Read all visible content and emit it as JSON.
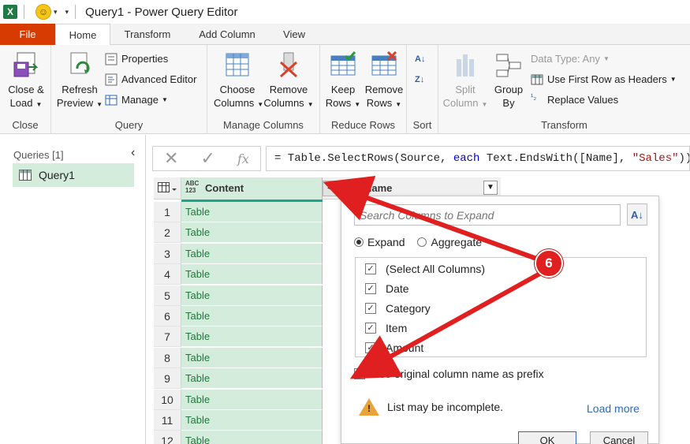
{
  "window": {
    "app_logo": "X",
    "title": "Query1 - Power Query Editor",
    "smiley": "☺"
  },
  "tabs": [
    {
      "label": "File"
    },
    {
      "label": "Home"
    },
    {
      "label": "Transform"
    },
    {
      "label": "Add Column"
    },
    {
      "label": "View"
    }
  ],
  "ribbon": {
    "close": {
      "close_load_line1": "Close &",
      "close_load_line2": "Load",
      "group": "Close"
    },
    "query": {
      "refresh_line1": "Refresh",
      "refresh_line2": "Preview",
      "properties": "Properties",
      "advanced_editor": "Advanced Editor",
      "manage": "Manage",
      "group": "Query"
    },
    "manage_columns": {
      "choose_line1": "Choose",
      "choose_line2": "Columns",
      "remove_line1": "Remove",
      "remove_line2": "Columns",
      "group": "Manage Columns"
    },
    "reduce_rows": {
      "keep_line1": "Keep",
      "keep_line2": "Rows",
      "remove_line1": "Remove",
      "remove_line2": "Rows",
      "group": "Reduce Rows"
    },
    "sort": {
      "group": "Sort"
    },
    "transform": {
      "split_line1": "Split",
      "split_line2": "Column",
      "group_by_line1": "Group",
      "group_by_line2": "By",
      "data_type": "Data Type: Any",
      "first_row_headers": "Use First Row as Headers",
      "replace_values": "Replace Values",
      "group": "Transform"
    }
  },
  "queries": {
    "header": "Queries [1]",
    "items": [
      {
        "label": "Query1"
      }
    ]
  },
  "formula": {
    "prefix": "= Table.SelectRows(Source, ",
    "keyword": "each",
    "middle": " Text.EndsWith([Name], ",
    "string": "\"Sales\"",
    "suffix": "))"
  },
  "grid": {
    "columns": [
      {
        "label": "Content",
        "type_top": "ABC",
        "type_bottom": "123"
      },
      {
        "label": "Name",
        "type_top": "A",
        "type_bottom": "B"
      }
    ],
    "rows": [
      {
        "num": "1",
        "content": "Table"
      },
      {
        "num": "2",
        "content": "Table"
      },
      {
        "num": "3",
        "content": "Table"
      },
      {
        "num": "4",
        "content": "Table"
      },
      {
        "num": "5",
        "content": "Table"
      },
      {
        "num": "6",
        "content": "Table"
      },
      {
        "num": "7",
        "content": "Table"
      },
      {
        "num": "8",
        "content": "Table"
      },
      {
        "num": "9",
        "content": "Table"
      },
      {
        "num": "10",
        "content": "Table"
      },
      {
        "num": "11",
        "content": "Table"
      },
      {
        "num": "12",
        "content": "Table"
      }
    ]
  },
  "expand_popup": {
    "search_placeholder": "Search Columns to Expand",
    "expand_label": "Expand",
    "aggregate_label": "Aggregate",
    "columns": [
      {
        "label": "(Select All Columns)",
        "checked": true
      },
      {
        "label": "Date",
        "checked": true
      },
      {
        "label": "Category",
        "checked": true
      },
      {
        "label": "Item",
        "checked": true
      },
      {
        "label": "Amount",
        "checked": true
      }
    ],
    "prefix_label": "Use original column name as prefix",
    "warning": "List may be incomplete.",
    "load_more": "Load more",
    "ok": "OK",
    "cancel": "Cancel"
  },
  "annotation": {
    "badge": "6",
    "color": "#e02020"
  },
  "colors": {
    "file_tab": "#d83b01",
    "selection_green": "#d4ecdc",
    "accent_teal": "#1ba689",
    "annotation_red": "#e02020"
  }
}
